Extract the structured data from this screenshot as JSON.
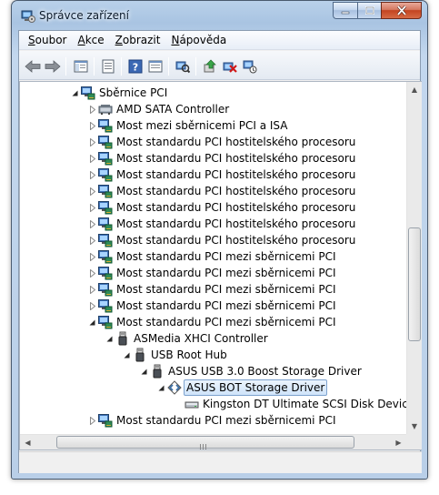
{
  "window": {
    "title": "Správce zařízení"
  },
  "menubar": [
    {
      "pre": "",
      "ul": "S",
      "post": "oubor"
    },
    {
      "pre": "",
      "ul": "A",
      "post": "kce"
    },
    {
      "pre": "",
      "ul": "Z",
      "post": "obrazit"
    },
    {
      "pre": "",
      "ul": "N",
      "post": "ápověda"
    }
  ],
  "toolbar": {
    "icons": [
      "back-arrow-icon",
      "forward-arrow-icon",
      "show-hide-tree-icon",
      "properties-icon",
      "help-icon",
      "view-icon",
      "scan-hardware-icon",
      "update-driver-icon",
      "disable-device-icon",
      "uninstall-device-icon"
    ]
  },
  "tree": [
    {
      "label": "Sběrnice PCI",
      "level": 0,
      "expander": "open",
      "icon": "pci-bus"
    },
    {
      "label": "AMD SATA Controller",
      "level": 1,
      "expander": "closed",
      "icon": "sata"
    },
    {
      "label": "Most mezi sběrnicemi PCI a ISA",
      "level": 1,
      "expander": "closed",
      "icon": "pci-device"
    },
    {
      "label": "Most standardu PCI hostitelského procesoru",
      "level": 1,
      "expander": "closed",
      "icon": "pci-device"
    },
    {
      "label": "Most standardu PCI hostitelského procesoru",
      "level": 1,
      "expander": "closed",
      "icon": "pci-device"
    },
    {
      "label": "Most standardu PCI hostitelského procesoru",
      "level": 1,
      "expander": "closed",
      "icon": "pci-device"
    },
    {
      "label": "Most standardu PCI hostitelského procesoru",
      "level": 1,
      "expander": "closed",
      "icon": "pci-device"
    },
    {
      "label": "Most standardu PCI hostitelského procesoru",
      "level": 1,
      "expander": "closed",
      "icon": "pci-device"
    },
    {
      "label": "Most standardu PCI hostitelského procesoru",
      "level": 1,
      "expander": "closed",
      "icon": "pci-device"
    },
    {
      "label": "Most standardu PCI hostitelského procesoru",
      "level": 1,
      "expander": "closed",
      "icon": "pci-device"
    },
    {
      "label": "Most standardu PCI mezi sběrnicemi PCI",
      "level": 1,
      "expander": "closed",
      "icon": "pci-device"
    },
    {
      "label": "Most standardu PCI mezi sběrnicemi PCI",
      "level": 1,
      "expander": "closed",
      "icon": "pci-device"
    },
    {
      "label": "Most standardu PCI mezi sběrnicemi PCI",
      "level": 1,
      "expander": "closed",
      "icon": "pci-device"
    },
    {
      "label": "Most standardu PCI mezi sběrnicemi PCI",
      "level": 1,
      "expander": "closed",
      "icon": "pci-device"
    },
    {
      "label": "Most standardu PCI mezi sběrnicemi PCI",
      "level": 1,
      "expander": "open",
      "icon": "pci-device"
    },
    {
      "label": "ASMedia XHCI Controller",
      "level": 2,
      "expander": "open",
      "icon": "usb"
    },
    {
      "label": "USB Root Hub",
      "level": 3,
      "expander": "open",
      "icon": "usb"
    },
    {
      "label": "ASUS USB 3.0 Boost Storage Driver",
      "level": 4,
      "expander": "open",
      "icon": "usb"
    },
    {
      "label": "ASUS BOT Storage Driver",
      "level": 5,
      "expander": "open",
      "icon": "storage-controller",
      "selected": true
    },
    {
      "label": "Kingston DT Ultimate SCSI Disk Device",
      "level": 6,
      "expander": "none",
      "icon": "disk"
    },
    {
      "label": "Most standardu PCI mezi sběrnicemi PCI",
      "level": 1,
      "expander": "closed",
      "icon": "pci-device"
    }
  ],
  "colors": {
    "selection_border": "#7da2ce",
    "selection_fill": "#cfe4fa",
    "window_frame": "#b9d1ea"
  }
}
